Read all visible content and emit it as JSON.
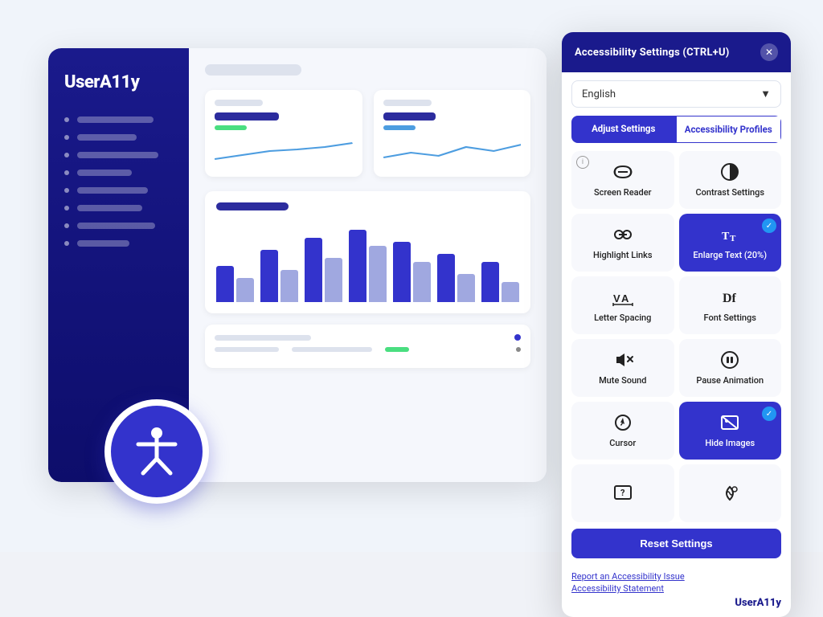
{
  "scene": {
    "bg_color": "#f0f4fa"
  },
  "dashboard": {
    "logo": "UserA11y",
    "sidebar_items": [
      {
        "line_width": "70%"
      },
      {
        "line_width": "55%"
      },
      {
        "line_width": "75%"
      },
      {
        "line_width": "50%"
      },
      {
        "line_width": "65%"
      },
      {
        "line_width": "60%"
      },
      {
        "line_width": "72%"
      },
      {
        "line_width": "48%"
      }
    ]
  },
  "panel": {
    "title": "Accessibility Settings (CTRL+U)",
    "close_label": "✕",
    "language": "English",
    "language_placeholder": "English",
    "tab_adjust": "Adjust Settings",
    "tab_profiles": "Accessibility Profiles",
    "settings": [
      {
        "id": "screen-reader",
        "label": "Screen Reader",
        "active": false,
        "info": true
      },
      {
        "id": "contrast",
        "label": "Contrast Settings",
        "active": false,
        "info": false
      },
      {
        "id": "highlight-links",
        "label": "Highlight Links",
        "active": false,
        "info": false
      },
      {
        "id": "enlarge-text",
        "label": "Enlarge Text (20%)",
        "active": true,
        "check": true
      },
      {
        "id": "letter-spacing",
        "label": "Letter Spacing",
        "active": false,
        "info": false
      },
      {
        "id": "font-settings",
        "label": "Font Settings",
        "active": false,
        "info": false
      },
      {
        "id": "mute-sound",
        "label": "Mute Sound",
        "active": false,
        "info": false
      },
      {
        "id": "pause-animation",
        "label": "Pause Animation",
        "active": false,
        "info": false
      },
      {
        "id": "cursor",
        "label": "Cursor",
        "active": false,
        "info": false
      },
      {
        "id": "hide-images",
        "label": "Hide Images",
        "active": true,
        "check": true
      },
      {
        "id": "help",
        "label": "",
        "active": false,
        "info": false
      },
      {
        "id": "color-blind",
        "label": "",
        "active": false,
        "info": false
      }
    ],
    "reset_label": "Reset Settings",
    "footer_link1": "Report an Accessibility Issue",
    "footer_link2": "Accessibility Statement",
    "brand": "UserA11y"
  }
}
